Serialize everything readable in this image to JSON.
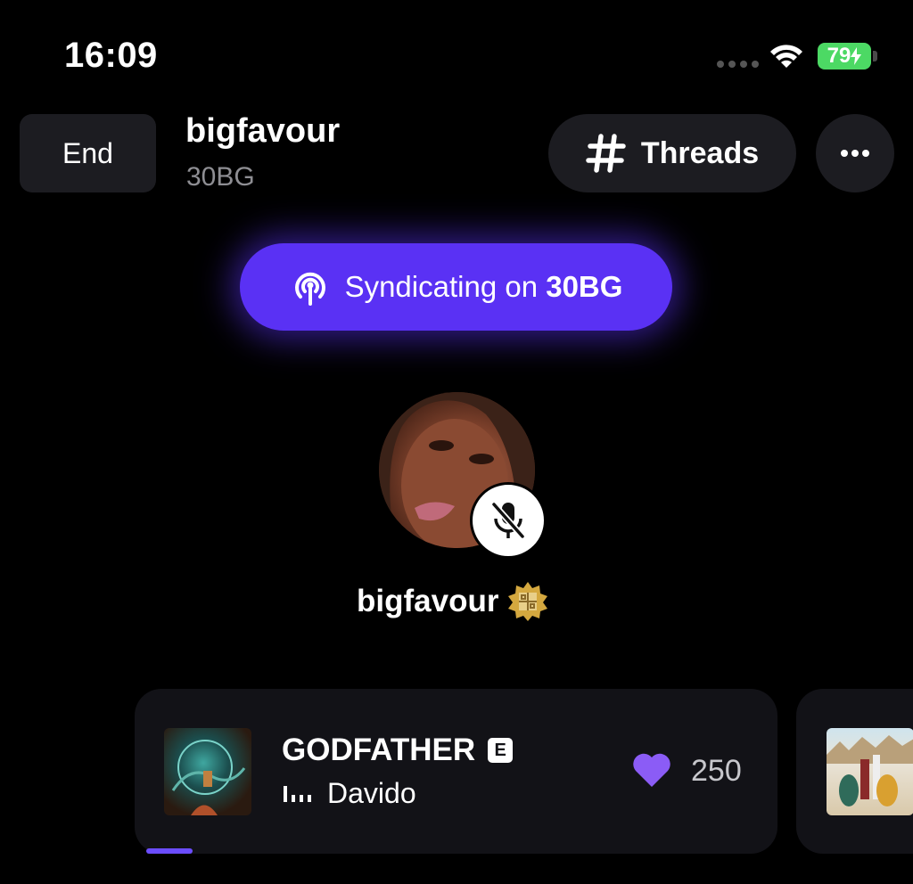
{
  "status_bar": {
    "time": "16:09",
    "battery": "79"
  },
  "header": {
    "end_label": "End",
    "room_name": "bigfavour",
    "room_sub": "30BG",
    "threads_label": "Threads"
  },
  "syndicating": {
    "prefix": "Syndicating on ",
    "target": "30BG"
  },
  "speaker": {
    "name": "bigfavour"
  },
  "now_playing": {
    "title": "GODFATHER",
    "explicit": "E",
    "artist": "Davido",
    "likes": "250"
  },
  "colors": {
    "accent": "#5a31f4",
    "background": "#000000",
    "card": "#121217",
    "heart": "#8b5cf6",
    "battery": "#4cd964"
  },
  "icons": [
    "wifi-icon",
    "hash-icon",
    "more-icon",
    "broadcast-icon",
    "mic-off-icon",
    "verified-badge-icon",
    "heart-icon",
    "equalizer-icon"
  ]
}
